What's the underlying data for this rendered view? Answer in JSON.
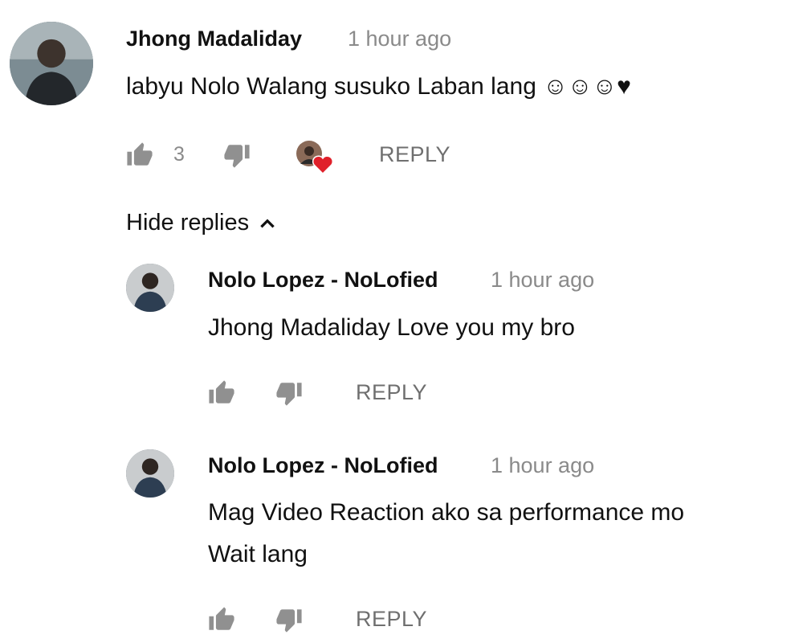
{
  "comment": {
    "author": "Jhong Madaliday",
    "time": "1 hour ago",
    "text": "labyu Nolo Walang susuko Laban lang ☺☺☺♥",
    "like_count": "3",
    "reply_label": "REPLY",
    "hide_replies_label": "Hide replies"
  },
  "replies": [
    {
      "author": "Nolo Lopez - NoLofied",
      "time": "1 hour ago",
      "line1": "Jhong Madaliday Love you my bro",
      "line2": "",
      "reply_label": "REPLY"
    },
    {
      "author": "Nolo Lopez - NoLofied",
      "time": "1 hour ago",
      "line1": "Mag Video Reaction ako sa performance mo",
      "line2": "Wait lang",
      "reply_label": "REPLY"
    }
  ],
  "icons": {
    "like": "thumbs-up-icon",
    "dislike": "thumbs-down-icon",
    "hide": "chevron-up-icon",
    "hearted": "creator-heart-icon"
  },
  "colors": {
    "heart": "#e0202a",
    "icon_gray": "#909090",
    "text": "#111111",
    "meta": "#8a8a8a"
  }
}
